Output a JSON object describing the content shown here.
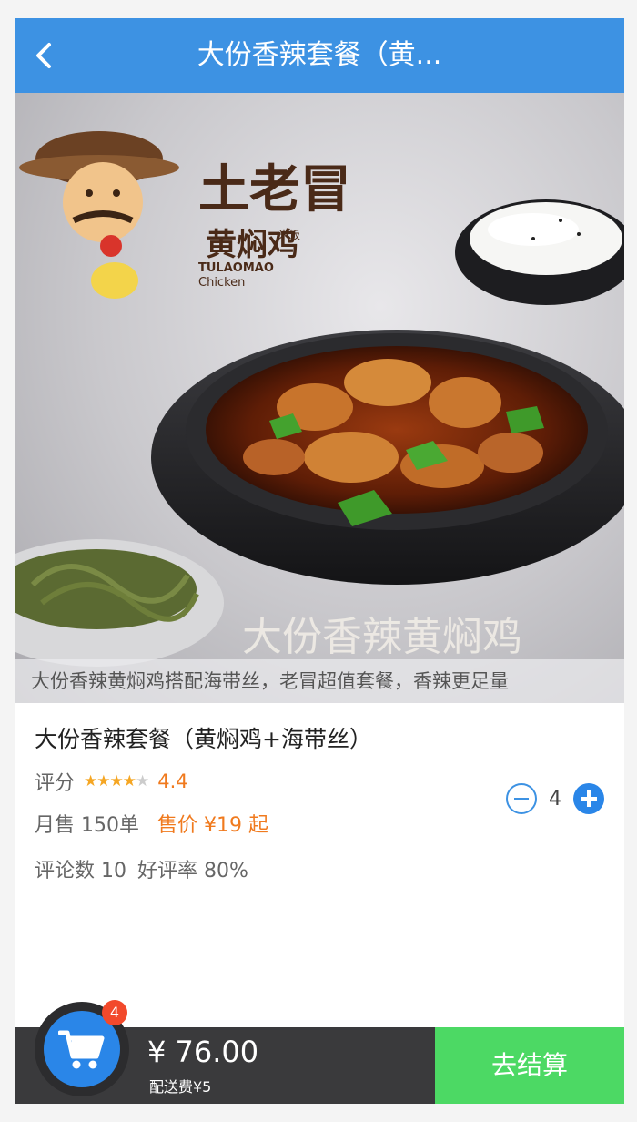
{
  "header": {
    "title": "大份香辣套餐（黄..."
  },
  "hero": {
    "brand_logo": "土老冒 黄焖鸡 米饭 TULAOMAO Chicken",
    "caption": "大份香辣黄焖鸡搭配海带丝，老冒超值套餐，香辣更足量",
    "overlay_text": "大份香辣黄焖鸡"
  },
  "product": {
    "name": "大份香辣套餐（黄焖鸡+海带丝）",
    "rating_label": "评分",
    "rating_value": "4.4",
    "rating": 4.4,
    "sales_text": "月售 150单",
    "price_text": "售价 ¥19 起",
    "comments_text": "评论数 10",
    "good_rate_text": "好评率 80%"
  },
  "quantity": {
    "value": "4"
  },
  "cart": {
    "badge": "4",
    "total": "¥ 76.00",
    "delivery_fee": "配送费¥5",
    "checkout_label": "去结算"
  },
  "colors": {
    "primary": "#3d92e3",
    "accent": "#f07a1e",
    "checkout": "#4cd964",
    "badge": "#f2492b"
  },
  "icons": {
    "back": "chevron-left-icon",
    "cart": "shopping-cart-icon",
    "minus": "minus-circle-icon",
    "plus": "plus-circle-icon",
    "star": "star-icon"
  }
}
